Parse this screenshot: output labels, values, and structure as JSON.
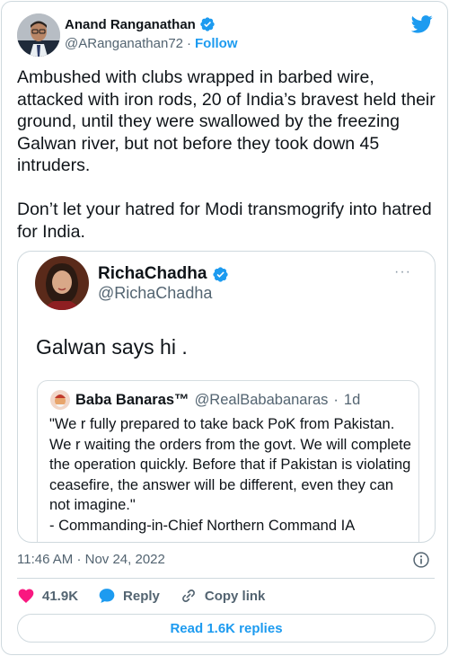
{
  "author": {
    "name": "Anand Ranganathan",
    "handle": "@ARanganathan72",
    "separator": "·",
    "follow_label": "Follow",
    "avatar_icon": "profile-photo",
    "verified_icon": "verified-badge-icon"
  },
  "platform_icon": "twitter-bird-icon",
  "tweet_text": "Ambushed with clubs wrapped in barbed wire, attacked with iron rods, 20 of India’s bravest held their ground, until they were swallowed by the freezing Galwan river, but not before they took down 45 intruders.\n\nDon’t let your hatred for Modi transmogrify into hatred for India.",
  "quoted": {
    "name": "RichaChadha",
    "handle": "@RichaChadha",
    "more": "···",
    "text": "Galwan says hi .",
    "inner": {
      "name": "Baba Banaras™",
      "handle": "@RealBababanaras",
      "separator": "·",
      "time": "1d",
      "text": "\"We r fully prepared to take back PoK from Pakistan. We r waiting the orders from the govt. We will complete the operation quickly. Before that if Pakistan is violating ceasefire, the answer will be different, even they can not imagine.\"\n- Commanding-in-Chief Northern Command IA"
    }
  },
  "meta": {
    "time": "11:46 AM",
    "separator": "·",
    "date": "Nov 24, 2022"
  },
  "actions": {
    "likes": "41.9K",
    "reply_label": "Reply",
    "copy_label": "Copy link"
  },
  "read_replies_label": "Read 1.6K replies",
  "colors": {
    "accent": "#1d9bf0",
    "like": "#f91880",
    "text": "#0f1419",
    "muted": "#536471",
    "border": "#cfd9de"
  }
}
